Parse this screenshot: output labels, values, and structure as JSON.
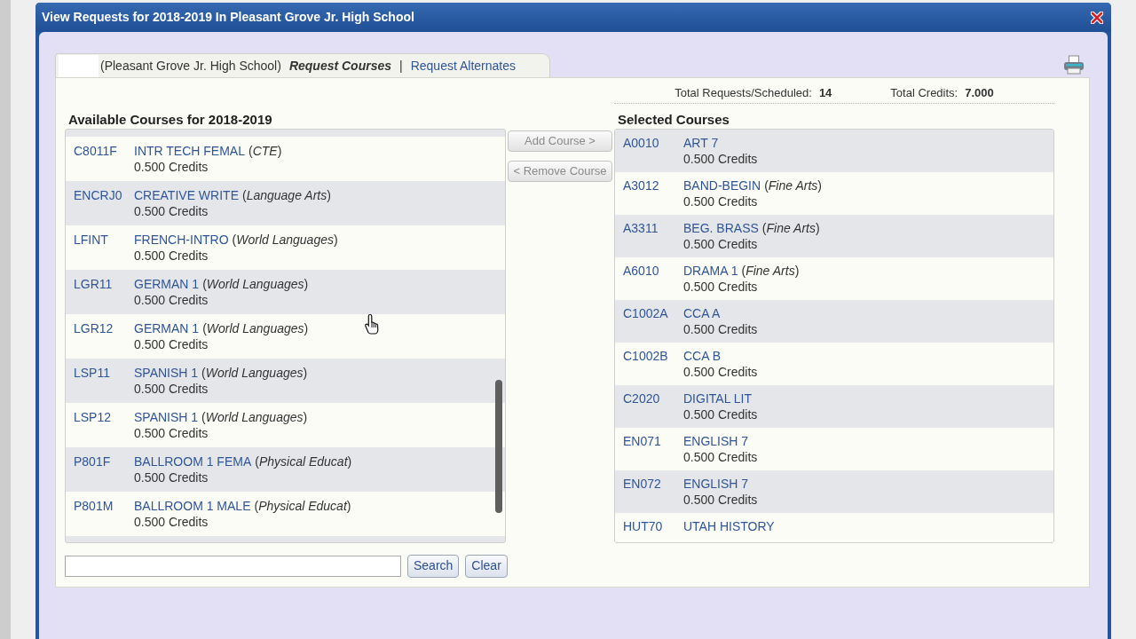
{
  "window": {
    "title": "View Requests for 2018-2019 In Pleasant Grove Jr. High School"
  },
  "tab_bar": {
    "school": "(Pleasant Grove Jr. High School)",
    "separator": "|",
    "views": [
      {
        "label": "Request Courses",
        "selected": true
      },
      {
        "label": "Request Alternates",
        "selected": false
      }
    ]
  },
  "totals": [
    {
      "label": "Total Requests/Scheduled:",
      "value": "14"
    },
    {
      "label": "Total Credits:",
      "value": "7.000"
    }
  ],
  "available_courses": {
    "heading": "Available Courses for 2018-2019",
    "courses": [
      {
        "code": "C8011F",
        "name": "INTR TECH FEMAL",
        "category": "(*CTE*)",
        "credits": "0.500 Credits"
      },
      {
        "code": "ENCRJ0",
        "name": "CREATIVE WRITE",
        "category": "(*Language Arts*)",
        "credits": "0.500 Credits"
      },
      {
        "code": "LFINT",
        "name": "FRENCH-INTRO",
        "category": "(*World Languages*)",
        "credits": "0.500 Credits"
      },
      {
        "code": "LGR11",
        "name": "GERMAN 1",
        "category": "(*World Languages*)",
        "credits": "0.500 Credits"
      },
      {
        "code": "LGR12",
        "name": "GERMAN 1",
        "category": "(*World Languages*)",
        "credits": "0.500 Credits"
      },
      {
        "code": "LSP11",
        "name": "SPANISH 1",
        "category": "(*World Languages*)",
        "credits": "0.500 Credits"
      },
      {
        "code": "LSP12",
        "name": "SPANISH 1",
        "category": "(*World Languages*)",
        "credits": "0.500 Credits"
      },
      {
        "code": "P801F",
        "name": "BALLROOM 1 FEMA",
        "category": "(*Physical Educat*)",
        "credits": "0.500 Credits"
      },
      {
        "code": "P801M",
        "name": "BALLROOM 1 MALE",
        "category": "(*Physical Educat*)",
        "credits": "0.500 Credits"
      }
    ]
  },
  "actions": [
    {
      "label": "Add Course >",
      "disabled": true
    },
    {
      "label": "< Remove Course",
      "disabled": true
    }
  ],
  "selected_courses": {
    "heading": "Selected Courses",
    "courses": [
      {
        "code": "A0010",
        "name": "ART 7",
        "credits": "0.500 Credits"
      },
      {
        "code": "A3012",
        "name": "BAND-BEGIN",
        "category": "(*Fine Arts*)",
        "credits": "0.500 Credits"
      },
      {
        "code": "A3311",
        "name": "BEG. BRASS",
        "category": "(*Fine Arts*)",
        "credits": "0.500 Credits"
      },
      {
        "code": "A6010",
        "name": "DRAMA 1",
        "category": "(*Fine Arts*)",
        "credits": "0.500 Credits"
      },
      {
        "code": "C1002A",
        "name": "CCA A",
        "credits": "0.500 Credits"
      },
      {
        "code": "C1002B",
        "name": "CCA B",
        "credits": "0.500 Credits"
      },
      {
        "code": "C2020",
        "name": "DIGITAL LIT",
        "credits": "0.500 Credits"
      },
      {
        "code": "EN071",
        "name": "ENGLISH 7",
        "credits": "0.500 Credits"
      },
      {
        "code": "EN072",
        "name": "ENGLISH 7",
        "credits": "0.500 Credits"
      },
      {
        "code": "HUT70",
        "name": "UTAH HISTORY"
      }
    ]
  },
  "search": {
    "buttons": [
      "Search",
      "Clear"
    ]
  }
}
